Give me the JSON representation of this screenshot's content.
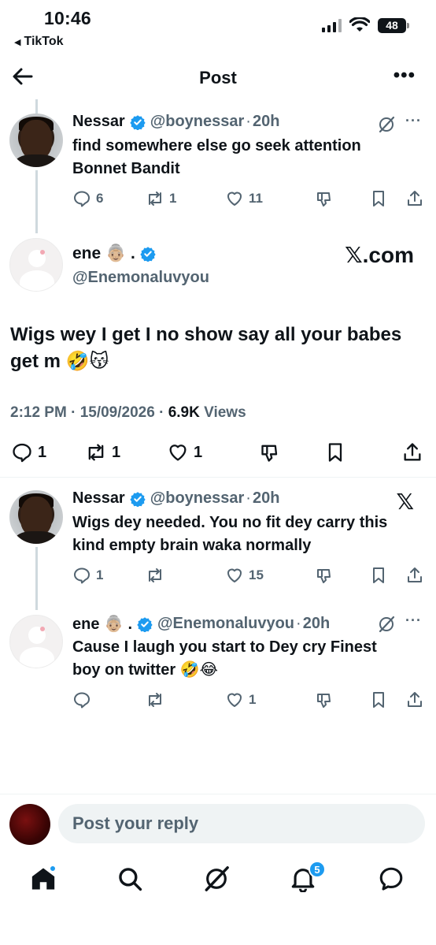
{
  "status": {
    "time": "10:46",
    "back_app": "TikTok",
    "battery": "48"
  },
  "header": {
    "title": "Post"
  },
  "reply1": {
    "name": "Nessar",
    "handle": "@boynessar",
    "time": "20h",
    "text": "find somewhere else go seek attention Bonnet Bandit",
    "replies": "6",
    "reposts": "1",
    "likes": "11"
  },
  "main": {
    "name": "ene 👵🏼 .",
    "handle": "@Enemonaluvyou",
    "source": "𝕏.com",
    "text": "Wigs wey I get I no show say all your babes get m 🤣😽",
    "time": "2:12 PM",
    "date": "15/09/2026",
    "views_count": "6.9K",
    "views_label": "Views",
    "replies": "1",
    "reposts": "1",
    "likes": "1"
  },
  "reply2": {
    "name": "Nessar",
    "handle": "@boynessar",
    "time": "20h",
    "text": "Wigs dey needed. You no fit dey carry this kind empty brain waka normally",
    "replies": "1",
    "reposts": "",
    "likes": "15"
  },
  "reply3": {
    "name": "ene 👵🏼 .",
    "handle": "@Enemonaluvyou",
    "time": "20h",
    "text": "Cause I laugh you start to Dey cry Finest boy on twitter 🤣😂",
    "replies": "",
    "reposts": "",
    "likes": "1"
  },
  "compose": {
    "placeholder": "Post your reply"
  },
  "nav": {
    "notifications_badge": "5"
  },
  "x_logo": "𝕏",
  "colors": {
    "accent": "#1d9bf0",
    "muted": "#536471",
    "text": "#0f1419"
  }
}
